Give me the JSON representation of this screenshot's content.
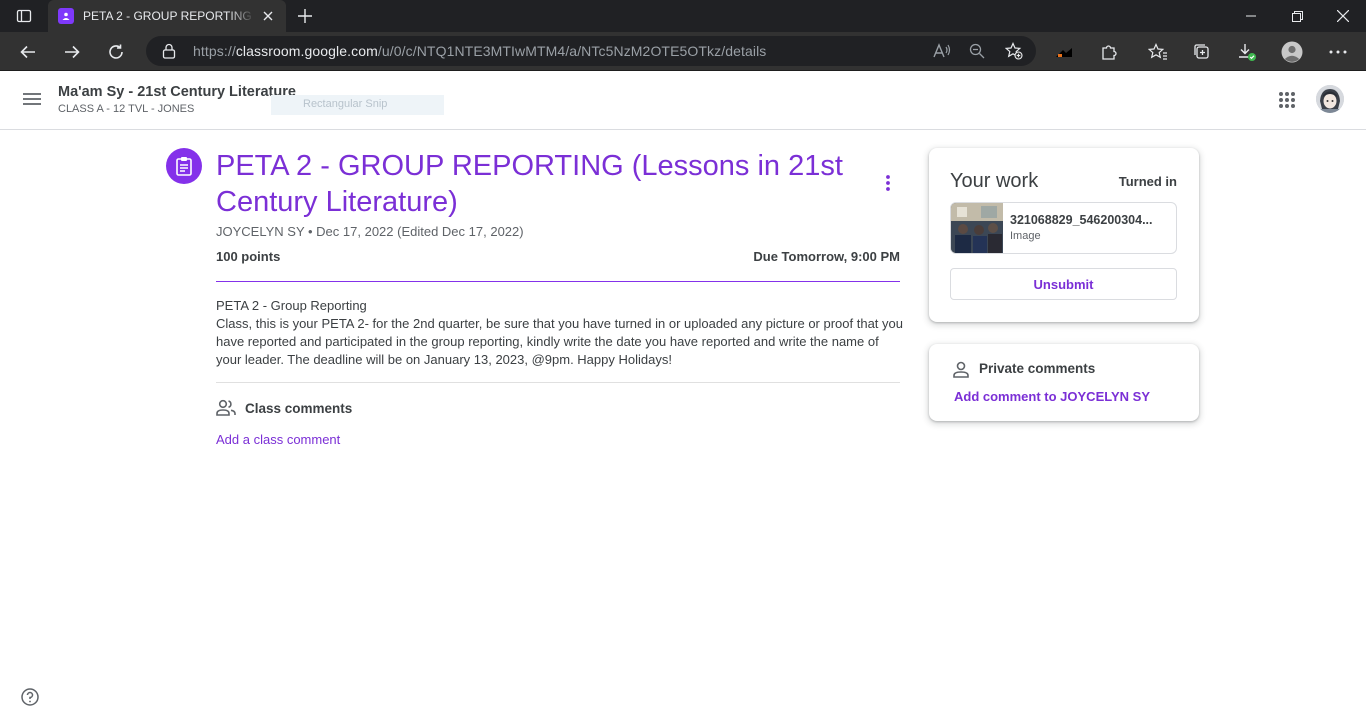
{
  "browser": {
    "tab_title": "PETA 2 - GROUP REPORTING (Lessons in 21st Century Literature)",
    "url_prefix": "https://",
    "url_host": "classroom.google.com",
    "url_path": "/u/0/c/NTQ1NTE3MTIwMTM4/a/NTc5NzM2OTE5OTkz/details"
  },
  "header": {
    "class_name": "Ma'am Sy - 21st Century Literature",
    "class_section": "CLASS A - 12 TVL - JONES",
    "snip_overlay": "Rectangular Snip"
  },
  "assignment": {
    "title": "PETA 2 - GROUP REPORTING (Lessons in 21st Century Literature)",
    "author": "JOYCELYN SY",
    "date": "Dec 17, 2022 (Edited Dec 17, 2022)",
    "points": "100 points",
    "due": "Due Tomorrow, 9:00 PM",
    "description_title": "PETA 2 - Group Reporting",
    "description_body": "Class, this is your PETA 2- for the 2nd quarter, be sure that you have turned in or uploaded any picture or proof that you have reported and participated in the group reporting, kindly write the date you have reported and write the name of your leader. The deadline will be on January 13, 2023, @9pm. Happy Holidays!"
  },
  "class_comments": {
    "label": "Class comments",
    "add_label": "Add a class comment"
  },
  "your_work": {
    "title": "Your work",
    "status": "Turned in",
    "attachment_name": "321068829_546200304...",
    "attachment_type": "Image",
    "unsubmit_label": "Unsubmit"
  },
  "private_comments": {
    "label": "Private comments",
    "add_label": "Add comment to JOYCELYN SY"
  },
  "colors": {
    "accent": "#7b2fd6",
    "accent_icon": "#8431ea",
    "chrome_dark": "#202124",
    "chrome_toolbar": "#323232"
  },
  "icons": {
    "tab_favicon": "classroom-icon",
    "assignment": "assignment-icon",
    "class_comments": "people-icon",
    "private_comments": "person-icon",
    "help": "help-icon"
  }
}
